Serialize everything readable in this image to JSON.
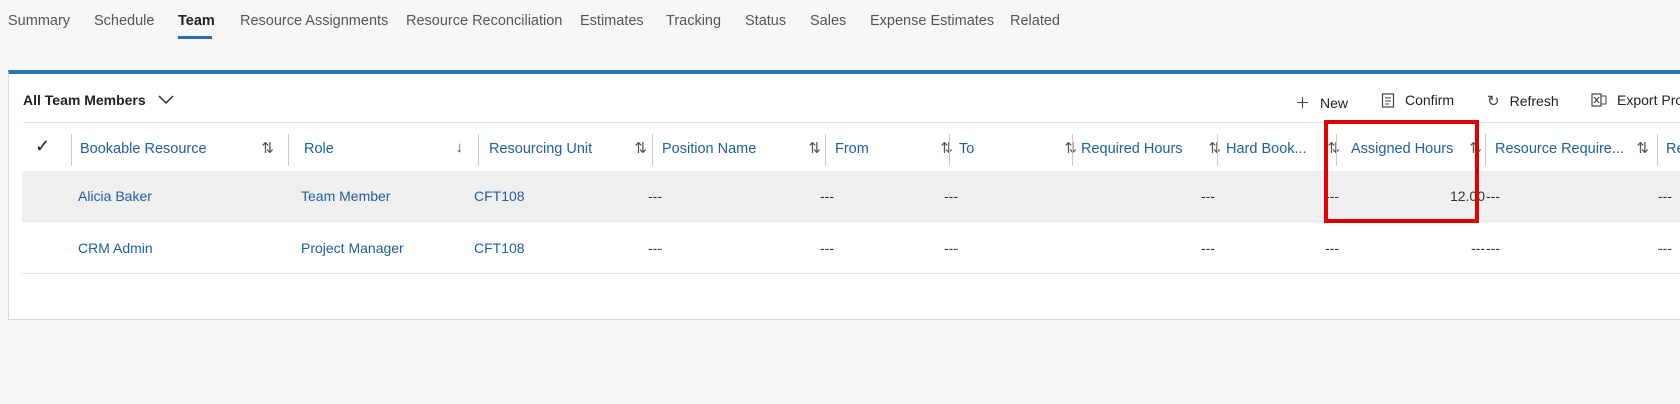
{
  "tabs": [
    {
      "label": "Summary"
    },
    {
      "label": "Schedule"
    },
    {
      "label": "Team"
    },
    {
      "label": "Resource Assignments"
    },
    {
      "label": "Resource Reconciliation"
    },
    {
      "label": "Estimates"
    },
    {
      "label": "Tracking"
    },
    {
      "label": "Status"
    },
    {
      "label": "Sales"
    },
    {
      "label": "Expense Estimates"
    },
    {
      "label": "Related"
    }
  ],
  "active_tab": "Team",
  "grid": {
    "view_name": "All Team Members",
    "commands": [
      {
        "label": "New",
        "icon": "plus-icon"
      },
      {
        "label": "Confirm",
        "icon": "clipboard-icon"
      },
      {
        "label": "Refresh",
        "icon": "refresh-icon"
      },
      {
        "label": "Export Pro",
        "icon": "excel-icon"
      }
    ],
    "columns": [
      {
        "label": "Bookable Resource",
        "sort": "both"
      },
      {
        "label": "Role",
        "sort": "down"
      },
      {
        "label": "Resourcing Unit",
        "sort": "both"
      },
      {
        "label": "Position Name",
        "sort": "both"
      },
      {
        "label": "From",
        "sort": "both"
      },
      {
        "label": "To",
        "sort": "both"
      },
      {
        "label": "Required Hours",
        "sort": "both"
      },
      {
        "label": "Hard Book...",
        "sort": "both"
      },
      {
        "label": "Assigned Hours",
        "sort": "both"
      },
      {
        "label": "Resource Require...",
        "sort": "both"
      },
      {
        "label": "Rec",
        "sort": "none"
      }
    ],
    "rows": [
      {
        "cells": [
          "Alicia Baker",
          "Team Member",
          "CFT108",
          "---",
          "---",
          "---",
          "---",
          "---",
          "12.00",
          "---",
          "---"
        ]
      },
      {
        "cells": [
          "CRM Admin",
          "Project Manager",
          "CFT108",
          "---",
          "---",
          "---",
          "---",
          "---",
          "---",
          "---",
          "---"
        ]
      }
    ]
  },
  "colors": {
    "accent": "#2f6fb3",
    "link": "#1f5f9e",
    "highlight": "#e00000"
  }
}
